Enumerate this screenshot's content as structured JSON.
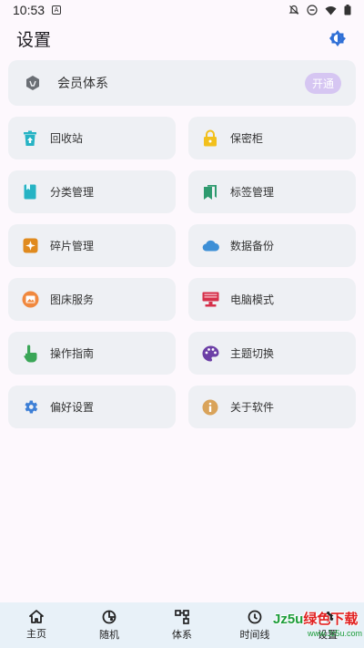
{
  "status_bar": {
    "time": "10:53",
    "app_badge": "A"
  },
  "header": {
    "title": "设置"
  },
  "member": {
    "label": "会员体系",
    "button": "开通"
  },
  "tiles": [
    {
      "label": "回收站",
      "icon": "trash-icon",
      "color": "#26b3c4"
    },
    {
      "label": "保密柜",
      "icon": "lock-icon",
      "color": "#f2c01c"
    },
    {
      "label": "分类管理",
      "icon": "book-icon",
      "color": "#26b3c4"
    },
    {
      "label": "标签管理",
      "icon": "bookmark-icon",
      "color": "#2e9a6f"
    },
    {
      "label": "碎片管理",
      "icon": "sparkle-icon",
      "color": "#e08a1e"
    },
    {
      "label": "数据备份",
      "icon": "cloud-icon",
      "color": "#3d8fd6"
    },
    {
      "label": "图床服务",
      "icon": "image-icon",
      "color": "#f0883e"
    },
    {
      "label": "电脑模式",
      "icon": "monitor-icon",
      "color": "#d6304a"
    },
    {
      "label": "操作指南",
      "icon": "hand-pointer-icon",
      "color": "#3aa657"
    },
    {
      "label": "主题切换",
      "icon": "palette-icon",
      "color": "#6c3fa6"
    },
    {
      "label": "偏好设置",
      "icon": "gear-icon",
      "color": "#3d7fd6"
    },
    {
      "label": "关于软件",
      "icon": "info-icon",
      "color": "#d9a35a"
    }
  ],
  "nav": [
    {
      "label": "主页",
      "icon": "home-icon"
    },
    {
      "label": "随机",
      "icon": "random-icon"
    },
    {
      "label": "体系",
      "icon": "hierarchy-icon"
    },
    {
      "label": "时间线",
      "icon": "clock-icon"
    },
    {
      "label": "设置",
      "icon": "gear-icon"
    }
  ],
  "watermark": {
    "brand_a": "Jz5u",
    "brand_b": "绿色下载",
    "url": "www.Jz5u.com"
  }
}
